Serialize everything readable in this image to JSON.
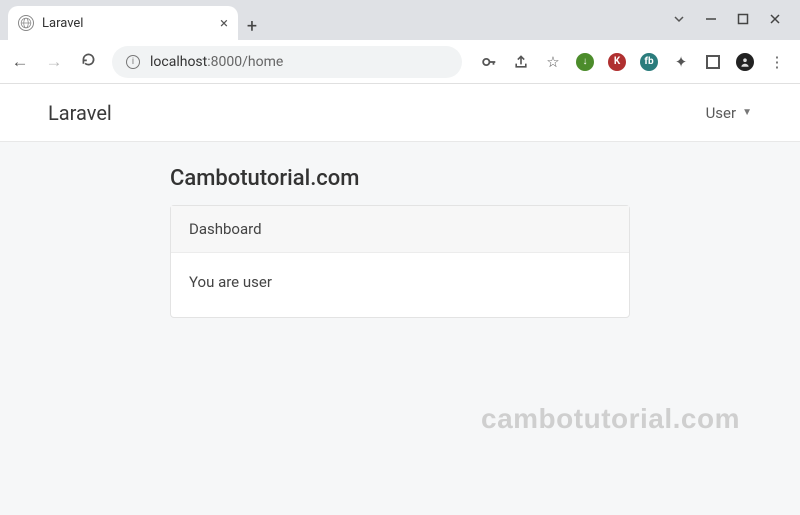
{
  "browser": {
    "tab_title": "Laravel",
    "url_host": "localhost",
    "url_port": ":8000",
    "url_path": "/home"
  },
  "navbar": {
    "brand": "Laravel",
    "user_label": "User"
  },
  "page": {
    "heading": "Cambotutorial.com",
    "card_header": "Dashboard",
    "card_body": "You are user"
  },
  "watermark": "cambotutorial.com"
}
